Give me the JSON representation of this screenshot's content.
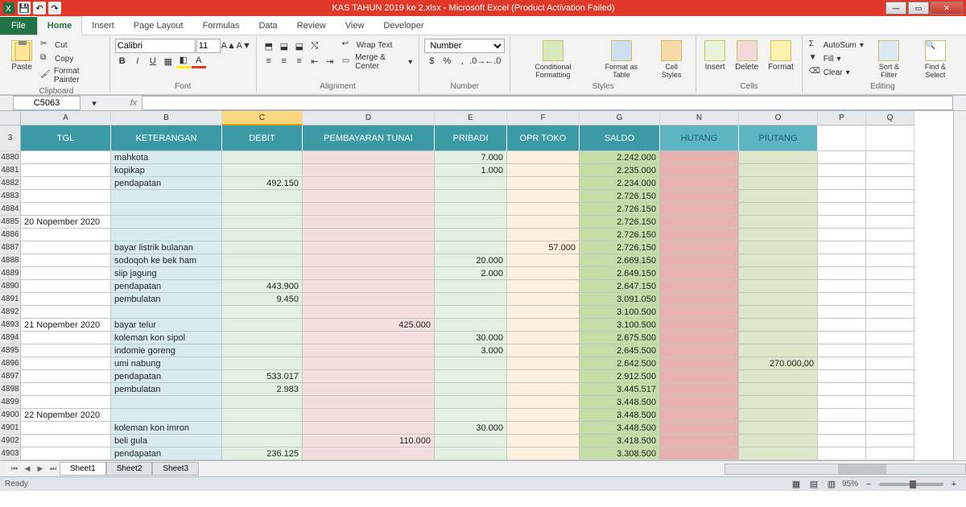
{
  "title": "KAS TAHUN 2019 ke 2.xlsx  -  Microsoft Excel (Product Activation Failed)",
  "tabs": {
    "file": "File",
    "home": "Home",
    "insert": "Insert",
    "page": "Page Layout",
    "formulas": "Formulas",
    "data": "Data",
    "review": "Review",
    "view": "View",
    "developer": "Developer"
  },
  "ribbon": {
    "clipboard": {
      "title": "Clipboard",
      "paste": "Paste",
      "cut": "Cut",
      "copy": "Copy",
      "painter": "Format Painter"
    },
    "font": {
      "title": "Font",
      "name": "Calibri",
      "size": "11"
    },
    "alignment": {
      "title": "Alignment",
      "wrap": "Wrap Text",
      "merge": "Merge & Center"
    },
    "number": {
      "title": "Number",
      "fmt": "Number"
    },
    "styles": {
      "title": "Styles",
      "cond": "Conditional Formatting",
      "table": "Format as Table",
      "cell": "Cell Styles"
    },
    "cells": {
      "title": "Cells",
      "insert": "Insert",
      "delete": "Delete",
      "format": "Format"
    },
    "editing": {
      "title": "Editing",
      "sum": "AutoSum",
      "fill": "Fill",
      "clear": "Clear",
      "sort": "Sort & Filter",
      "find": "Find & Select"
    }
  },
  "namebox": "C5063",
  "fx": "fx",
  "cols": [
    "A",
    "B",
    "C",
    "D",
    "E",
    "F",
    "G",
    "N",
    "O",
    "P",
    "Q"
  ],
  "rownum_start": 3,
  "header_row": {
    "A": "TGL",
    "B": "KETERANGAN",
    "C": "DEBIT",
    "D": "PEMBAYARAN TUNAI",
    "E": "PRIBADI",
    "F": "OPR TOKO",
    "G": "SALDO",
    "N": "HUTANG",
    "O": "PIUTANG"
  },
  "rows": [
    {
      "r": 4880,
      "B": "mahkota",
      "E": "7.000",
      "G": "2.242.000"
    },
    {
      "r": 4881,
      "B": "kopikap",
      "E": "1.000",
      "G": "2.235.000"
    },
    {
      "r": 4882,
      "B": "pendapatan",
      "C": "492.150",
      "G": "2.234.000"
    },
    {
      "r": 4883,
      "G": "2.726.150"
    },
    {
      "r": 4884,
      "G": "2.726.150"
    },
    {
      "r": 4885,
      "A": "20 Nopember 2020",
      "G": "2.726.150"
    },
    {
      "r": 4886,
      "G": "2.726.150"
    },
    {
      "r": 4887,
      "B": "bayar listrik bulanan",
      "F": "57.000",
      "G": "2.726.150"
    },
    {
      "r": 4888,
      "B": "sodoqoh ke bek ham",
      "E": "20.000",
      "G": "2.669.150"
    },
    {
      "r": 4889,
      "B": "siip jagung",
      "E": "2.000",
      "G": "2.649.150"
    },
    {
      "r": 4890,
      "B": "pendapatan",
      "C": "443.900",
      "G": "2.647.150"
    },
    {
      "r": 4891,
      "B": "pembulatan",
      "C": "9.450",
      "G": "3.091.050"
    },
    {
      "r": 4892,
      "G": "3.100.500"
    },
    {
      "r": 4893,
      "A": "21 Nopember 2020",
      "B": "bayar telur",
      "D": "425.000",
      "G": "3.100.500"
    },
    {
      "r": 4894,
      "B": "koleman kon sipol",
      "E": "30.000",
      "G": "2.675.500"
    },
    {
      "r": 4895,
      "B": "indomie goreng",
      "E": "3.000",
      "G": "2.645.500"
    },
    {
      "r": 4896,
      "B": "umi nabung",
      "G": "2.642.500",
      "O": "270.000,00"
    },
    {
      "r": 4897,
      "B": "pendapatan",
      "C": "533.017",
      "G": "2.912.500"
    },
    {
      "r": 4898,
      "B": "pembulatan",
      "C": "2.983",
      "G": "3.445.517"
    },
    {
      "r": 4899,
      "G": "3.448.500"
    },
    {
      "r": 4900,
      "A": "22 Nopember 2020",
      "G": "3.448.500"
    },
    {
      "r": 4901,
      "B": "koleman kon imron",
      "E": "30.000",
      "G": "3.448.500"
    },
    {
      "r": 4902,
      "B": "beli gula",
      "D": "110.000",
      "G": "3.418.500"
    },
    {
      "r": 4903,
      "B": "pendapatan",
      "C": "236.125",
      "G": "3.308.500"
    }
  ],
  "sheets": [
    "Sheet1",
    "Sheet2",
    "Sheet3"
  ],
  "status": "Ready",
  "zoom": "95%"
}
